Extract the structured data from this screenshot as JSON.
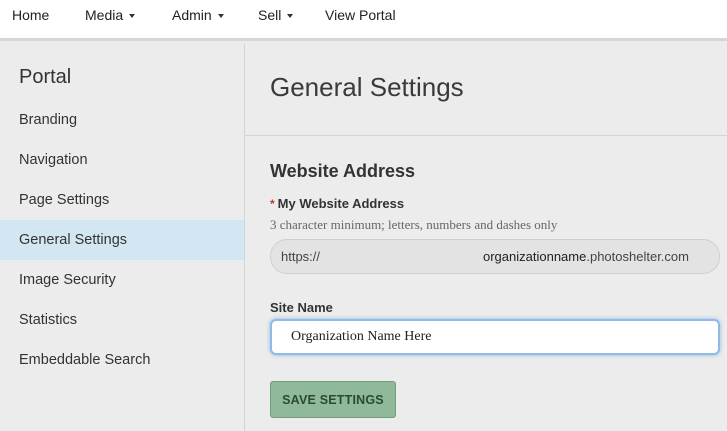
{
  "topnav": {
    "items": [
      {
        "label": "Home",
        "dropdown": false
      },
      {
        "label": "Media",
        "dropdown": true
      },
      {
        "label": "Admin",
        "dropdown": true
      },
      {
        "label": "Sell",
        "dropdown": true
      },
      {
        "label": "View Portal",
        "dropdown": false
      }
    ]
  },
  "sidebar": {
    "title": "Portal",
    "items": [
      {
        "label": "Branding"
      },
      {
        "label": "Navigation"
      },
      {
        "label": "Page Settings"
      },
      {
        "label": "General Settings",
        "active": true
      },
      {
        "label": "Image Security"
      },
      {
        "label": "Statistics"
      },
      {
        "label": "Embeddable Search"
      }
    ]
  },
  "main": {
    "title": "General Settings",
    "section_title": "Website Address",
    "website_address": {
      "required_marker": "*",
      "label": "My Website Address",
      "help": "3 character minimum; letters, numbers and dashes only",
      "prefix": "https://",
      "subdomain": "organizationname",
      "domain": ".photoshelter.com"
    },
    "site_name": {
      "label": "Site Name",
      "value": "Organization Name Here"
    },
    "save_label": "SAVE SETTINGS"
  },
  "colors": {
    "active_item_bg": "#d3e7f3",
    "save_button_bg": "#8fb998",
    "required_marker": "#c0392b",
    "input_focus_border": "#8fbbe6"
  }
}
